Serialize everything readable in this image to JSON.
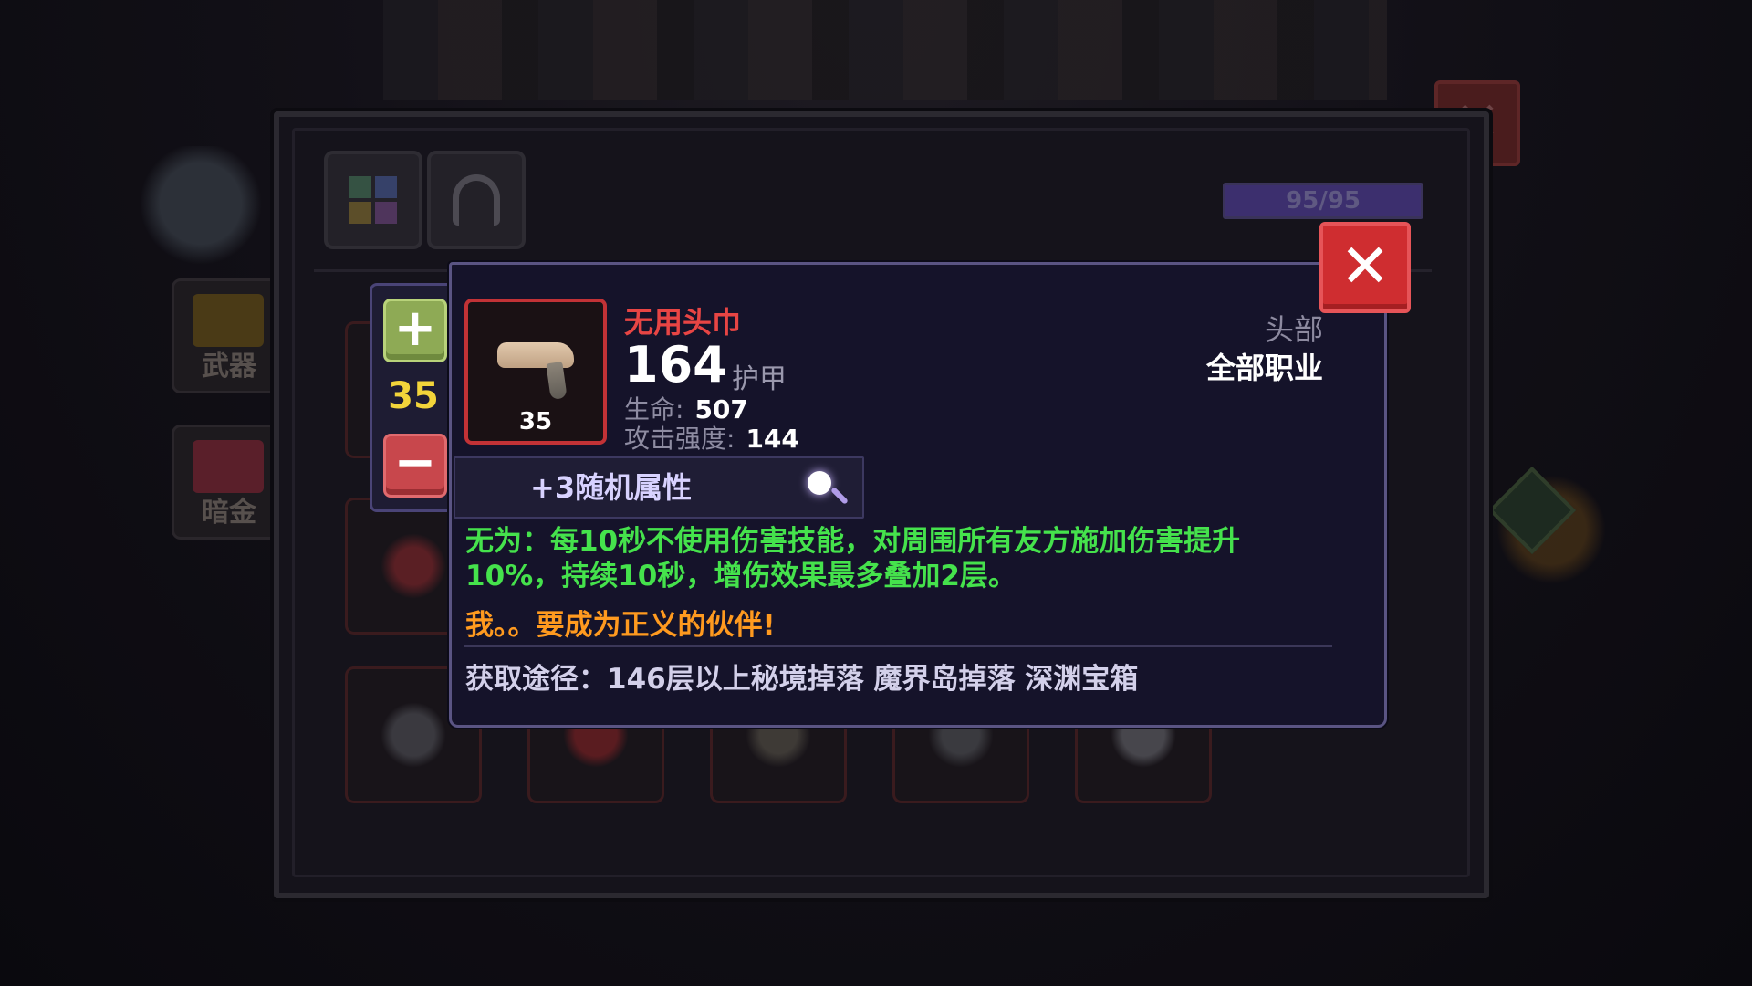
{
  "xp_bar": {
    "text": "95/95",
    "fill_fraction": 1.0
  },
  "side_tabs": [
    {
      "label": "武器",
      "icon": "sword-chest-icon"
    },
    {
      "label": "暗金",
      "icon": "dark-gold-chest-icon"
    }
  ],
  "tabs": [
    {
      "icon": "inventory-grid-icon"
    },
    {
      "icon": "helmet-icon"
    }
  ],
  "stepper": {
    "plus": "+",
    "quantity": "35",
    "minus": "−"
  },
  "item": {
    "name": "无用头巾",
    "level": "35",
    "armor_value": "164",
    "armor_label": "护甲",
    "stats": [
      {
        "label": "生命:",
        "value": "507"
      },
      {
        "label": "攻击强度:",
        "value": "144"
      }
    ],
    "slot_type": "头部",
    "class_type": "全部职业",
    "random_attr": "+3随机属性",
    "effect": "无为：每10秒不使用伤害技能，对周围所有友方施加伤害提升10%，持续10秒，增伤效果最多叠加2层。",
    "flavor": "我。。要成为正义的伙伴!",
    "source": "获取途径：146层以上秘境掉落 魔界岛掉落 深渊宝箱"
  },
  "close_label": "✕",
  "colors": {
    "item_name": "#e84544",
    "effect": "#45e24c",
    "flavor": "#ff9a1f",
    "quantity": "#f2d43a",
    "close_button": "#cf2d30",
    "plus_button": "#8eaa55",
    "minus_button": "#c8474c"
  }
}
